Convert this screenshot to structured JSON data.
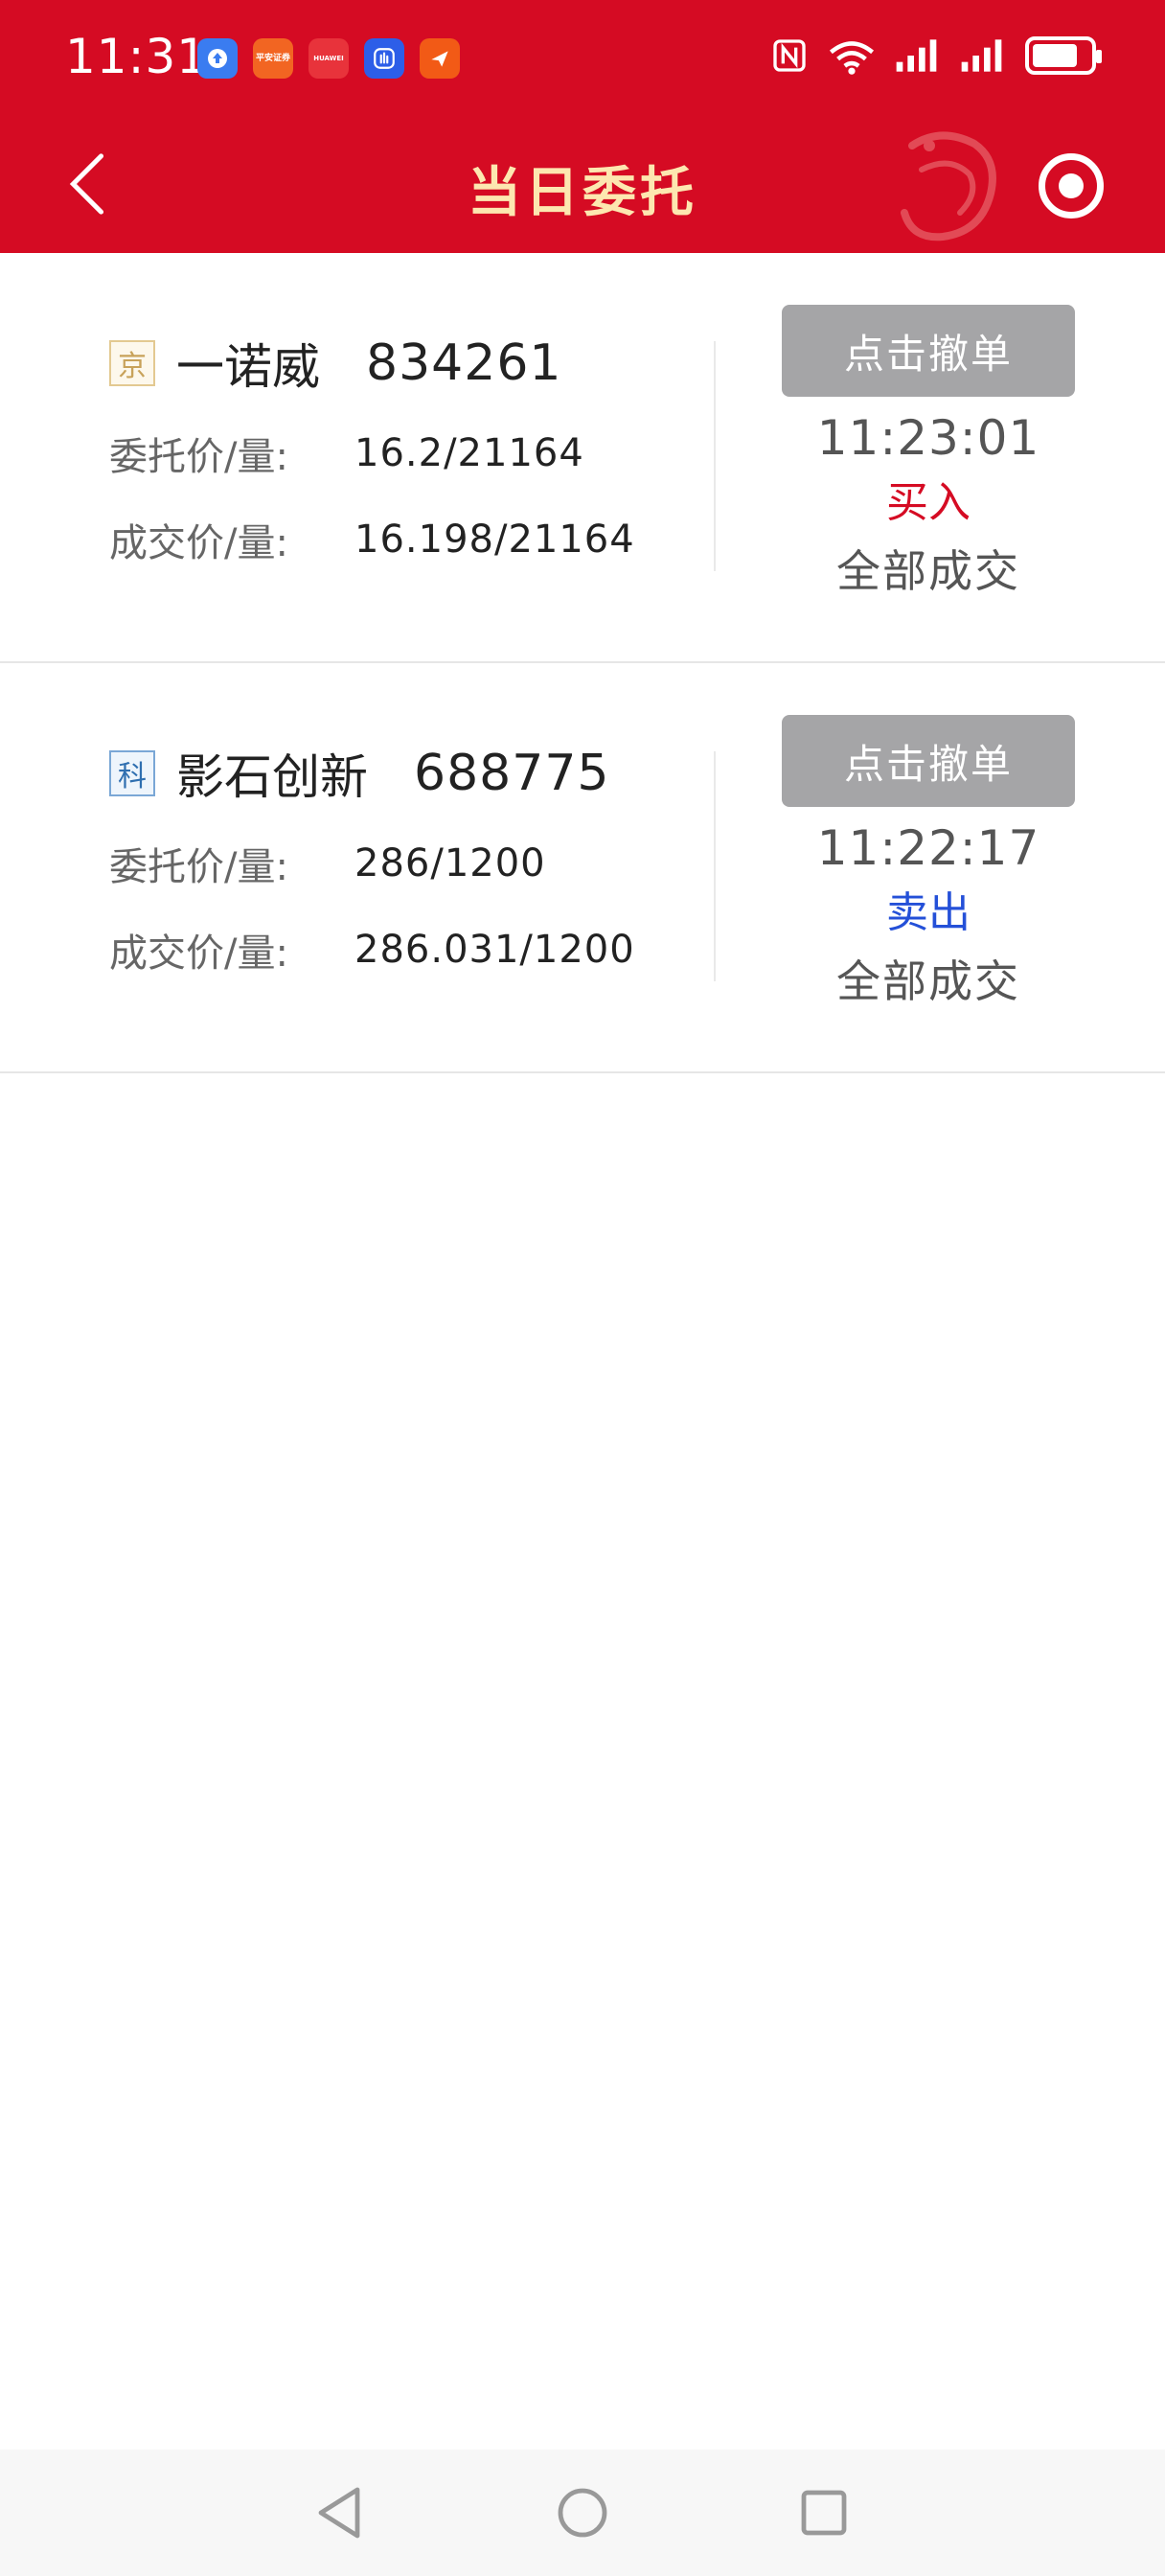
{
  "status_bar": {
    "time": "11:31",
    "icons": [
      "upload-app-icon",
      "pingan-securities-app-icon",
      "huawei-app-icon",
      "hand-app-icon",
      "paper-plane-app-icon",
      "nfc-icon",
      "wifi-6-icon",
      "signal-icon",
      "signal-icon",
      "battery-icon"
    ],
    "battery_level": 0.8,
    "app_icon_labels": {
      "pingan": "平安证券",
      "huawei": "HUAWEI"
    }
  },
  "nav": {
    "title": "当日委托",
    "back_icon": "chevron-left-icon",
    "right_icon": "record-icon"
  },
  "labels": {
    "order_price_qty": "委托价/量:",
    "deal_price_qty": "成交价/量:",
    "cancel_button": "点击撤单"
  },
  "orders": [
    {
      "market_tag": "京",
      "market_color": "#c8a25a",
      "name": "一诺威",
      "code": "834261",
      "order_value": "16.2/21164",
      "deal_value": "16.198/21164",
      "time": "11:23:01",
      "side": "买入",
      "side_color": "#d50b23",
      "status": "全部成交"
    },
    {
      "market_tag": "科",
      "market_color": "#2f6fb0",
      "name": "影石创新",
      "code": "688775",
      "order_value": "286/1200",
      "deal_value": "286.031/1200",
      "time": "11:22:17",
      "side": "卖出",
      "side_color": "#2450d8",
      "status": "全部成交"
    }
  ],
  "colors": {
    "header_red": "#d50b23",
    "title_gold": "#fde7b0",
    "cancel_button_gray": "#a5a5a7"
  },
  "system_nav": [
    "back-triangle-icon",
    "home-circle-icon",
    "recents-square-icon"
  ]
}
